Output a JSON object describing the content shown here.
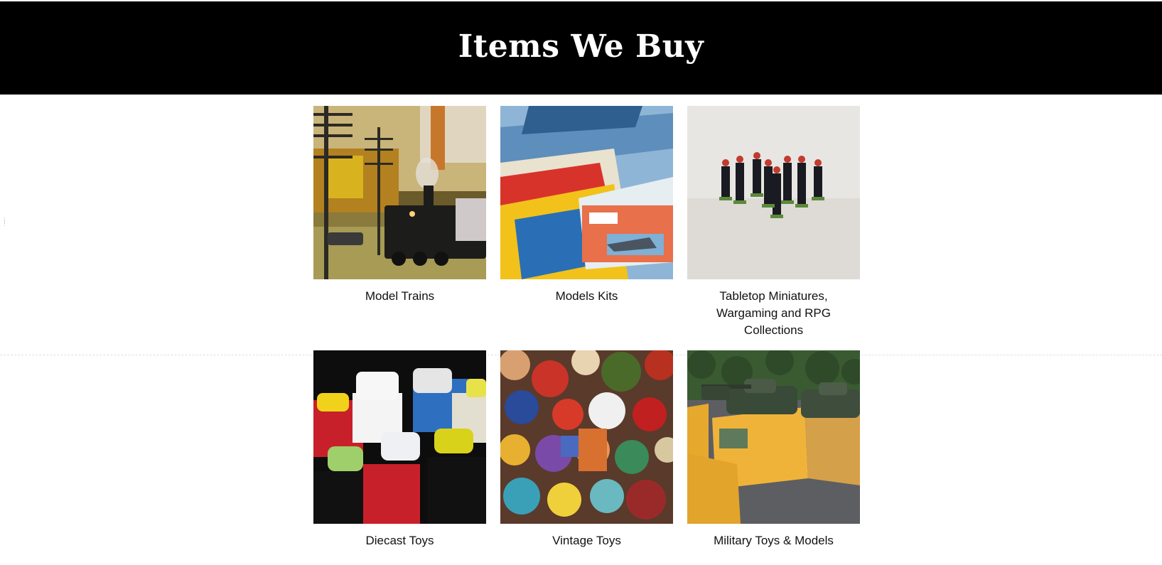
{
  "header": {
    "title": "Items We Buy",
    "background": "#000000",
    "text_color": "#ffffff"
  },
  "categories": [
    {
      "label": "Model Trains",
      "image": "model-trains-photo"
    },
    {
      "label": "Models Kits",
      "image": "model-kits-photo"
    },
    {
      "label": "Tabletop Miniatures, Wargaming and RPG Collections",
      "image": "tabletop-miniatures-photo"
    },
    {
      "label": "Diecast Toys",
      "image": "diecast-toys-photo"
    },
    {
      "label": "Vintage Toys",
      "image": "vintage-toys-photo"
    },
    {
      "label": "Military Toys & Models",
      "image": "military-toys-photo"
    }
  ]
}
